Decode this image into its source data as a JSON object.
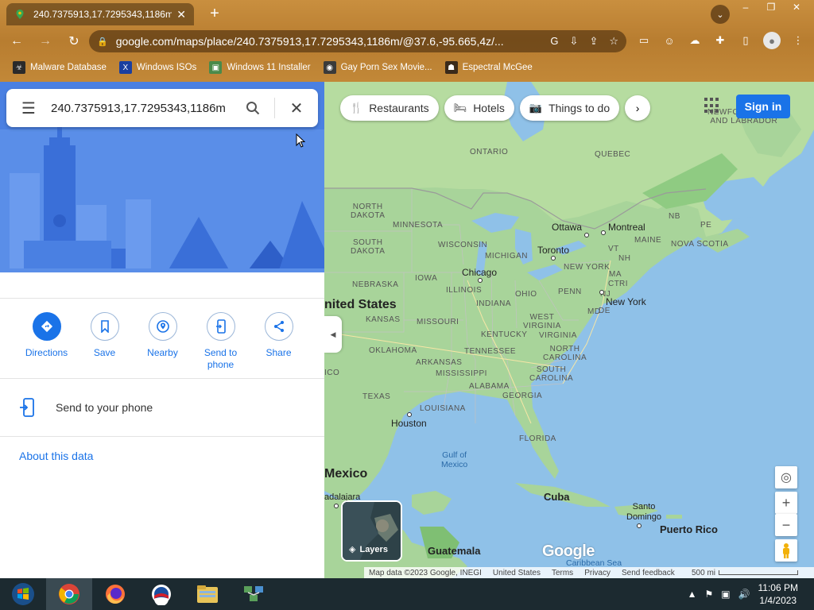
{
  "browser": {
    "tab_title": "240.7375913,17.7295343,1186m",
    "tab_close": "✕",
    "new_tab": "+",
    "window_controls": [
      "–",
      "❐",
      "✕"
    ],
    "tab_search": "⌄",
    "url": "google.com/maps/place/240.7375913,17.7295343,1186m/@37.6,-95.665,4z/...",
    "bookmarks": [
      {
        "label": "Malware Database",
        "icon": "malware-icon",
        "color": "#2a2a2a",
        "glyph": "☣"
      },
      {
        "label": "Windows ISOs",
        "icon": "x-icon",
        "color": "#1a3fa0",
        "glyph": "X"
      },
      {
        "label": "Windows 11 Installer",
        "icon": "windows-installer-icon",
        "color": "#2a6a2a",
        "glyph": "▣"
      },
      {
        "label": "Gay Porn Sex Movie...",
        "icon": "site-icon",
        "color": "#3a3a3a",
        "glyph": "◉"
      },
      {
        "label": "Espectral McGee",
        "icon": "site-icon",
        "color": "#3a2a1a",
        "glyph": "☗"
      }
    ]
  },
  "search": {
    "query": "240.7375913,17.7295343,1186m"
  },
  "actions": [
    {
      "label": "Directions",
      "icon": "directions-icon",
      "name": "directions-button",
      "primary": true
    },
    {
      "label": "Save",
      "icon": "bookmark-icon",
      "name": "save-button",
      "primary": false
    },
    {
      "label": "Nearby",
      "icon": "nearby-icon",
      "name": "nearby-button",
      "primary": false
    },
    {
      "label": "Send to phone",
      "icon": "send-to-phone-icon",
      "name": "send-to-phone-button",
      "primary": false
    },
    {
      "label": "Share",
      "icon": "share-icon",
      "name": "share-button",
      "primary": false
    }
  ],
  "send_to_phone": "Send to your phone",
  "about": "About this data",
  "map": {
    "chips": [
      {
        "label": "Restaurants",
        "icon": "restaurant-icon",
        "glyph": "🍴"
      },
      {
        "label": "Hotels",
        "icon": "hotel-icon",
        "glyph": "🛏"
      },
      {
        "label": "Things to do",
        "icon": "camera-icon",
        "glyph": "📷"
      }
    ],
    "signin": "Sign in",
    "layers_label": "Layers",
    "google_logo": "Google",
    "footer": {
      "data": "Map data ©2023 Google, INEGI",
      "country": "United States",
      "terms": "Terms",
      "privacy": "Privacy",
      "feedback": "Send feedback",
      "scale": "500 mi"
    },
    "region_labels": {
      "newfoundland": "NEWFOUNDLAND\nAND LABRADOR",
      "ontario": "ONTARIO",
      "quebec": "QUEBEC",
      "north_dakota": "NORTH\nDAKOTA",
      "minnesota": "MINNESOTA",
      "south_dakota": "SOUTH\nDAKOTA",
      "wisconsin": "WISCONSIN",
      "michigan": "MICHIGAN",
      "nebraska": "NEBRASKA",
      "iowa": "IOWA",
      "illinois": "ILLINOIS",
      "indiana": "INDIANA",
      "ohio": "OHIO",
      "penn": "PENN",
      "new_york_state": "NEW YORK",
      "vt": "VT",
      "nh": "NH",
      "ma": "MA",
      "ct": "CT",
      "ri": "RI",
      "maine": "MAINE",
      "nb": "NB",
      "pe": "PE",
      "nova_scotia": "NOVA SCOTIA",
      "kansas": "KANSAS",
      "missouri": "MISSOURI",
      "kentucky": "KENTUCKY",
      "west_virginia": "WEST\nVIRGINIA",
      "virginia": "VIRGINIA",
      "md": "MD",
      "nj": "NJ",
      "de": "DE",
      "oklahoma": "OKLAHOMA",
      "arkansas": "ARKANSAS",
      "tennessee": "TENNESSEE",
      "north_carolina": "NORTH\nCAROLINA",
      "mississippi": "MISSISSIPPI",
      "alabama": "ALABAMA",
      "georgia": "GEORGIA",
      "south_carolina": "SOUTH\nCAROLINA",
      "texas": "TEXAS",
      "louisiana": "LOUISIANA",
      "florida": "FLORIDA",
      "ico": "ICO"
    },
    "cities": {
      "ottawa": "Ottawa",
      "montreal": "Montreal",
      "toronto": "Toronto",
      "chicago": "Chicago",
      "new_york": "New York",
      "houston": "Houston",
      "santo_domingo": "Santo\nDomingo"
    },
    "big_labels": {
      "us": "nited States",
      "mexico": "Mexico",
      "cuba": "Cuba",
      "puerto_rico": "Puerto Rico",
      "guatemala": "Guatemala",
      "guadalajara": "adalajara"
    },
    "seas": {
      "gulf": "Gulf of\nMexico",
      "caribbean": "Caribbean Sea"
    }
  },
  "taskbar": {
    "time": "11:06 PM",
    "date": "1/4/2023"
  }
}
